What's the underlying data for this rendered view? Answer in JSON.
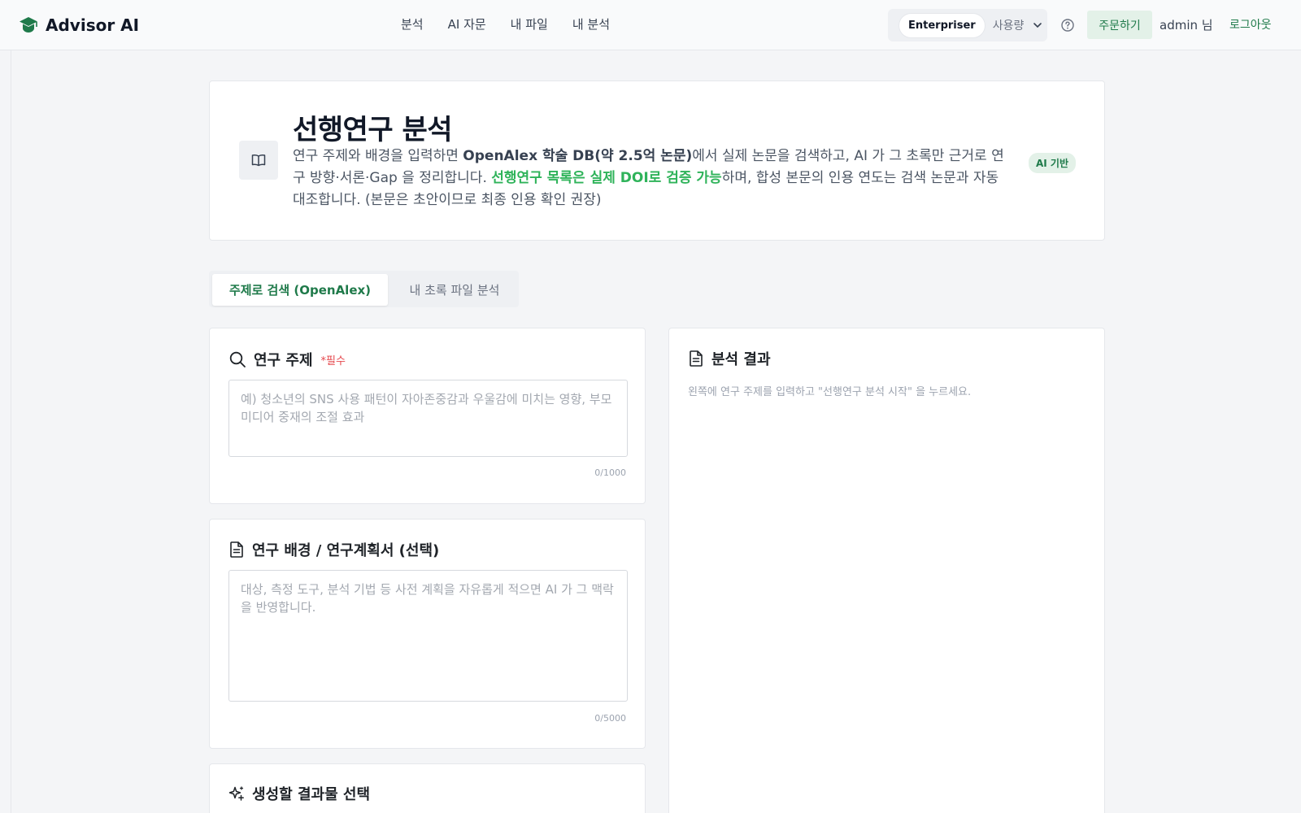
{
  "header": {
    "brand": "Advisor AI",
    "nav": [
      "분석",
      "AI 자문",
      "내 파일",
      "내 분석"
    ],
    "plan_badge": "Enterpriser",
    "plan_usage": "사용량",
    "order_label": "주문하기",
    "user_label": "admin 님",
    "logout_label": "로그아웃"
  },
  "intro": {
    "title": "선행연구 분석",
    "desc_1": "연구 주제와 배경을 입력하면 ",
    "desc_bold": "OpenAlex 학술 DB(약 2.5억 논문)",
    "desc_2": "에서 실제 논문을 검색하고, AI 가 그 초록만 근거로 연구 방향·서론·Gap 을 정리합니다. ",
    "desc_green": "선행연구 목록은 실제 DOI로 검증 가능",
    "desc_3": "하며, 합성 본문의 인용 연도는 검색 논문과 자동 대조합니다. (본문은 초안이므로 최종 인용 확인 권장)",
    "badge": "AI 기반"
  },
  "tabs": {
    "active": "주제로 검색 (OpenAlex)",
    "other": "내 초록 파일 분석"
  },
  "topic": {
    "title": "연구 주제",
    "required": "*필수",
    "placeholder": "예) 청소년의 SNS 사용 패턴이 자아존중감과 우울감에 미치는 영향, 부모 미디어 중재의 조절 효과",
    "counter": "0/1000"
  },
  "background": {
    "title": "연구 배경 / 연구계획서 (선택)",
    "placeholder": "대상, 측정 도구, 분석 기법 등 사전 계획을 자유롭게 적으면 AI 가 그 맥락을 반영합니다.",
    "counter": "0/5000"
  },
  "outputs": {
    "title": "생성할 결과물 선택"
  },
  "result": {
    "title": "분석 결과",
    "hint": "왼쪽에 연구 주제를 입력하고 \"선행연구 분석 시작\" 을 누르세요."
  }
}
